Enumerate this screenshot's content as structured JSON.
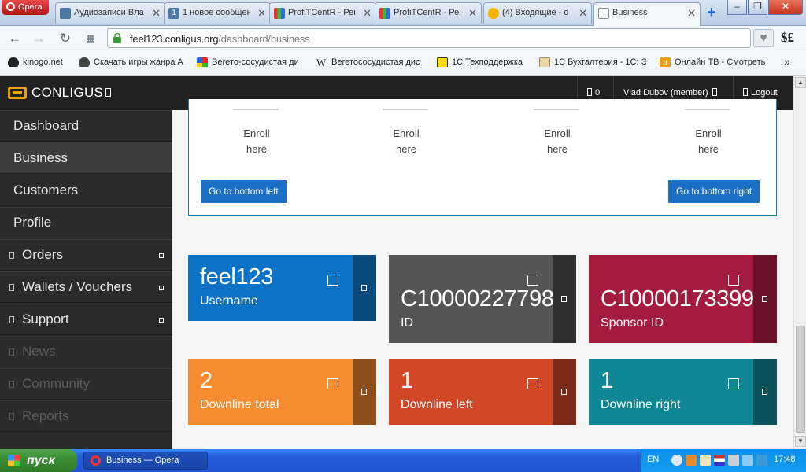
{
  "browser": {
    "menu_label": "Opera",
    "tabs": [
      {
        "label": "Аудиозаписи Вла"
      },
      {
        "label": "1 новое сообщен"
      },
      {
        "label": "ProfiTCentR - Рег"
      },
      {
        "label": "ProfiTCentR - Рег"
      },
      {
        "label": "(4) Входящие - d"
      },
      {
        "label": "Business"
      }
    ],
    "url_host": "feel123.conligus.org",
    "url_path": "/dashboard/business",
    "extension_label": "$£"
  },
  "bookmarks": [
    {
      "label": "kinogo.net"
    },
    {
      "label": "Скачать игры жанра А"
    },
    {
      "label": "Вегето-сосудистая ди"
    },
    {
      "label": "Вегетососудистая дис"
    },
    {
      "label": "1С:Техподдержка"
    },
    {
      "label": "1С Бухгалтерия - 1С: Э"
    },
    {
      "label": "Онлайн ТВ - Смотреть"
    }
  ],
  "topnav": {
    "brand": "CONLIGUS",
    "notifications": "0",
    "user": "Vlad Dubov (member)",
    "logout": "Logout"
  },
  "sidebar": {
    "items": [
      {
        "label": "Dashboard"
      },
      {
        "label": "Business"
      },
      {
        "label": "Customers"
      },
      {
        "label": "Profile"
      },
      {
        "label": "Orders"
      },
      {
        "label": "Wallets / Vouchers"
      },
      {
        "label": "Support"
      },
      {
        "label": "News"
      },
      {
        "label": "Community"
      },
      {
        "label": "Reports"
      }
    ]
  },
  "enroll": {
    "slots": [
      {
        "label": "Enroll here"
      },
      {
        "label": "Enroll here"
      },
      {
        "label": "Enroll here"
      },
      {
        "label": "Enroll here"
      }
    ],
    "bottom_left": "Go to bottom left",
    "bottom_right": "Go to bottom right"
  },
  "tiles": [
    {
      "value": "feel123",
      "label": "Username",
      "color": "#0b72c5",
      "side": "#0b4a7c"
    },
    {
      "value": "C10000227798",
      "label": "ID",
      "color": "#555555",
      "side": "#2f2f2f"
    },
    {
      "value": "C10000173399",
      "label": "Sponsor ID",
      "color": "#a31c3d",
      "side": "#6b1127"
    },
    {
      "value": "2",
      "label": "Downline total",
      "color": "#f68c30",
      "side": "#8c4e1a"
    },
    {
      "value": "1",
      "label": "Downline left",
      "color": "#d24726",
      "side": "#7a2818"
    },
    {
      "value": "1",
      "label": "Downline right",
      "color": "#0f8797",
      "side": "#0b525b"
    }
  ],
  "taskbar": {
    "start": "пуск",
    "window": "Business — Opera",
    "lang": "EN",
    "time": "17:48"
  }
}
